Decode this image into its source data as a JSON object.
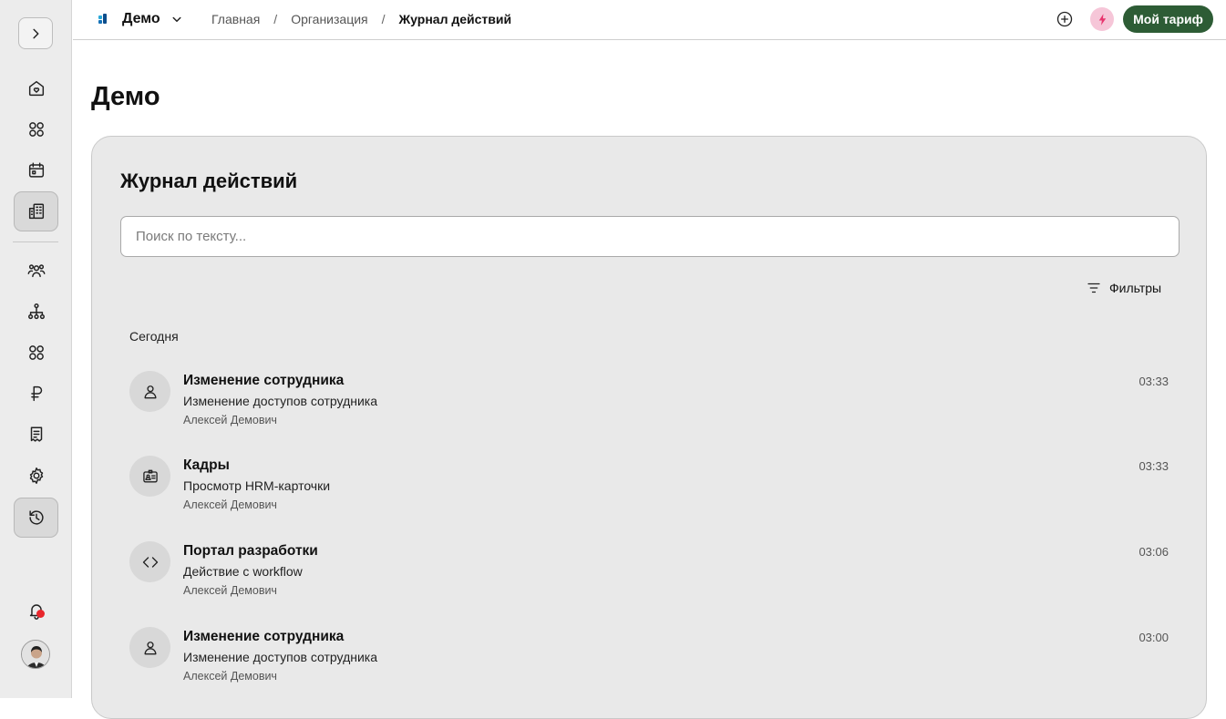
{
  "app": {
    "org_name": "Демо",
    "plan_button": "Мой тариф"
  },
  "breadcrumb": [
    "Главная",
    "Организация",
    "Журнал действий"
  ],
  "page": {
    "title": "Демо",
    "card_title": "Журнал действий",
    "search_placeholder": "Поиск по тексту...",
    "filters_label": "Фильтры",
    "group_label": "Сегодня"
  },
  "entries": [
    {
      "icon": "user-icon",
      "title": "Изменение сотрудника",
      "desc": "Изменение доступов сотрудника",
      "user": "Алексей Демович",
      "time": "03:33"
    },
    {
      "icon": "id-card-icon",
      "title": "Кадры",
      "desc": "Просмотр HRM-карточки",
      "user": "Алексей Демович",
      "time": "03:33"
    },
    {
      "icon": "code-icon",
      "title": "Портал разработки",
      "desc": "Действие с workflow",
      "user": "Алексей Демович",
      "time": "03:06"
    },
    {
      "icon": "user-icon",
      "title": "Изменение сотрудника",
      "desc": "Изменение доступов сотрудника",
      "user": "Алексей Демович",
      "time": "03:00"
    }
  ],
  "colors": {
    "accent": "#2d5c35",
    "badge_pink": "#f6c6d8",
    "bolt": "#e8356e",
    "notification_dot": "#e8262c"
  }
}
